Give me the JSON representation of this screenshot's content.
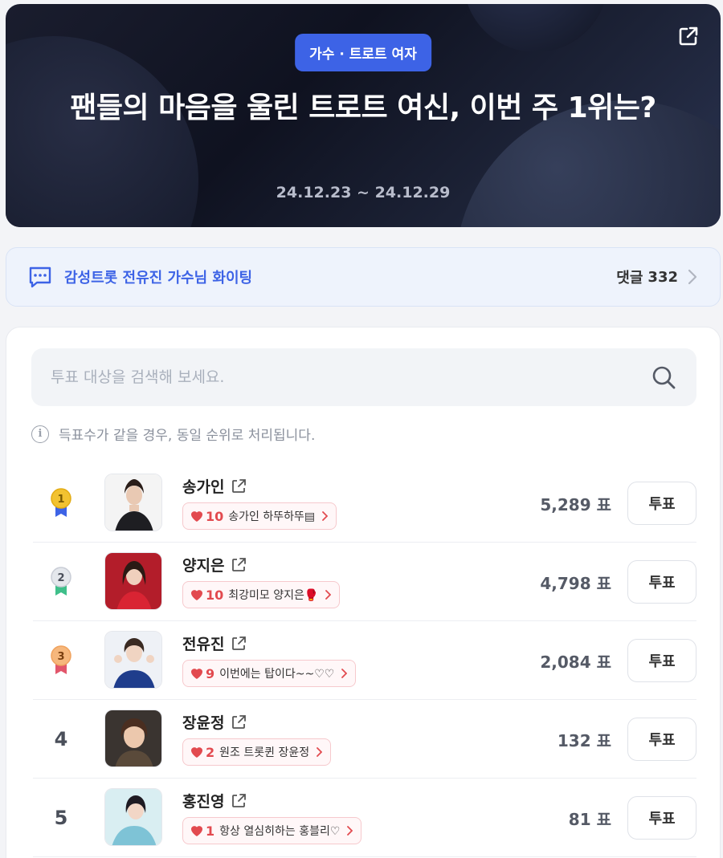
{
  "hero": {
    "badge": "가수 · 트로트 여자",
    "title": "팬들의 마음을 울린 트로트 여신, 이번 주 1위는?",
    "date_range": "24.12.23 ~ 24.12.29"
  },
  "comment_bar": {
    "message": "감성트롯 전유진 가수님 화이팅",
    "count_label": "댓글",
    "count": "332"
  },
  "search": {
    "placeholder": "투표 대상을 검색해 보세요."
  },
  "notice": "득표수가 같을 경우, 동일 순위로 처리됩니다.",
  "vote_button_label": "투표",
  "ranking": [
    {
      "rank": "1",
      "medal": "gold",
      "name": "송가인",
      "hearts": "10",
      "cheer": "송가인 하뚜하뚜▤",
      "votes": "5,289 표"
    },
    {
      "rank": "2",
      "medal": "silver",
      "name": "양지은",
      "hearts": "10",
      "cheer": "최강미모 양지은🥊",
      "votes": "4,798 표"
    },
    {
      "rank": "3",
      "medal": "bronze",
      "name": "전유진",
      "hearts": "9",
      "cheer": "이번에는 탑이다~~♡♡",
      "votes": "2,084 표"
    },
    {
      "rank": "4",
      "medal": "",
      "name": "장윤정",
      "hearts": "2",
      "cheer": "원조 트롯퀸 장윤정",
      "votes": "132 표"
    },
    {
      "rank": "5",
      "medal": "",
      "name": "홍진영",
      "hearts": "1",
      "cheer": "항상 열심히하는 홍블리♡",
      "votes": "81 표"
    }
  ],
  "colors": {
    "accent": "#3d63e6",
    "heart": "#e24a4f",
    "gold": "#f2c230",
    "silver": "#c9cdd6",
    "bronze": "#f0a35e"
  }
}
